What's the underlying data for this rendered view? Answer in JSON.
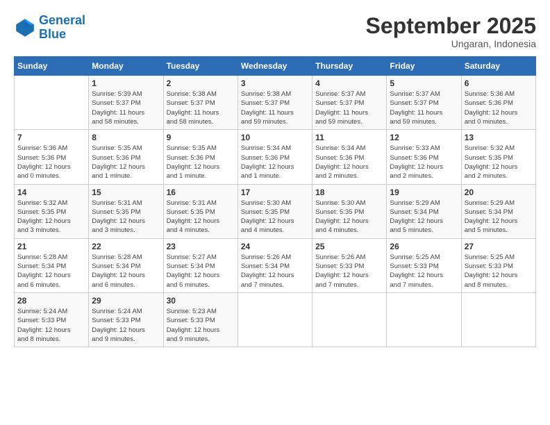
{
  "logo": {
    "line1": "General",
    "line2": "Blue"
  },
  "header": {
    "month": "September 2025",
    "location": "Ungaran, Indonesia"
  },
  "days_of_week": [
    "Sunday",
    "Monday",
    "Tuesday",
    "Wednesday",
    "Thursday",
    "Friday",
    "Saturday"
  ],
  "weeks": [
    [
      {
        "num": "",
        "info": ""
      },
      {
        "num": "1",
        "info": "Sunrise: 5:39 AM\nSunset: 5:37 PM\nDaylight: 11 hours\nand 58 minutes."
      },
      {
        "num": "2",
        "info": "Sunrise: 5:38 AM\nSunset: 5:37 PM\nDaylight: 11 hours\nand 58 minutes."
      },
      {
        "num": "3",
        "info": "Sunrise: 5:38 AM\nSunset: 5:37 PM\nDaylight: 11 hours\nand 59 minutes."
      },
      {
        "num": "4",
        "info": "Sunrise: 5:37 AM\nSunset: 5:37 PM\nDaylight: 11 hours\nand 59 minutes."
      },
      {
        "num": "5",
        "info": "Sunrise: 5:37 AM\nSunset: 5:37 PM\nDaylight: 11 hours\nand 59 minutes."
      },
      {
        "num": "6",
        "info": "Sunrise: 5:36 AM\nSunset: 5:36 PM\nDaylight: 12 hours\nand 0 minutes."
      }
    ],
    [
      {
        "num": "7",
        "info": "Sunrise: 5:36 AM\nSunset: 5:36 PM\nDaylight: 12 hours\nand 0 minutes."
      },
      {
        "num": "8",
        "info": "Sunrise: 5:35 AM\nSunset: 5:36 PM\nDaylight: 12 hours\nand 1 minute."
      },
      {
        "num": "9",
        "info": "Sunrise: 5:35 AM\nSunset: 5:36 PM\nDaylight: 12 hours\nand 1 minute."
      },
      {
        "num": "10",
        "info": "Sunrise: 5:34 AM\nSunset: 5:36 PM\nDaylight: 12 hours\nand 1 minute."
      },
      {
        "num": "11",
        "info": "Sunrise: 5:34 AM\nSunset: 5:36 PM\nDaylight: 12 hours\nand 2 minutes."
      },
      {
        "num": "12",
        "info": "Sunrise: 5:33 AM\nSunset: 5:36 PM\nDaylight: 12 hours\nand 2 minutes."
      },
      {
        "num": "13",
        "info": "Sunrise: 5:32 AM\nSunset: 5:35 PM\nDaylight: 12 hours\nand 2 minutes."
      }
    ],
    [
      {
        "num": "14",
        "info": "Sunrise: 5:32 AM\nSunset: 5:35 PM\nDaylight: 12 hours\nand 3 minutes."
      },
      {
        "num": "15",
        "info": "Sunrise: 5:31 AM\nSunset: 5:35 PM\nDaylight: 12 hours\nand 3 minutes."
      },
      {
        "num": "16",
        "info": "Sunrise: 5:31 AM\nSunset: 5:35 PM\nDaylight: 12 hours\nand 4 minutes."
      },
      {
        "num": "17",
        "info": "Sunrise: 5:30 AM\nSunset: 5:35 PM\nDaylight: 12 hours\nand 4 minutes."
      },
      {
        "num": "18",
        "info": "Sunrise: 5:30 AM\nSunset: 5:35 PM\nDaylight: 12 hours\nand 4 minutes."
      },
      {
        "num": "19",
        "info": "Sunrise: 5:29 AM\nSunset: 5:34 PM\nDaylight: 12 hours\nand 5 minutes."
      },
      {
        "num": "20",
        "info": "Sunrise: 5:29 AM\nSunset: 5:34 PM\nDaylight: 12 hours\nand 5 minutes."
      }
    ],
    [
      {
        "num": "21",
        "info": "Sunrise: 5:28 AM\nSunset: 5:34 PM\nDaylight: 12 hours\nand 6 minutes."
      },
      {
        "num": "22",
        "info": "Sunrise: 5:28 AM\nSunset: 5:34 PM\nDaylight: 12 hours\nand 6 minutes."
      },
      {
        "num": "23",
        "info": "Sunrise: 5:27 AM\nSunset: 5:34 PM\nDaylight: 12 hours\nand 6 minutes."
      },
      {
        "num": "24",
        "info": "Sunrise: 5:26 AM\nSunset: 5:34 PM\nDaylight: 12 hours\nand 7 minutes."
      },
      {
        "num": "25",
        "info": "Sunrise: 5:26 AM\nSunset: 5:33 PM\nDaylight: 12 hours\nand 7 minutes."
      },
      {
        "num": "26",
        "info": "Sunrise: 5:25 AM\nSunset: 5:33 PM\nDaylight: 12 hours\nand 7 minutes."
      },
      {
        "num": "27",
        "info": "Sunrise: 5:25 AM\nSunset: 5:33 PM\nDaylight: 12 hours\nand 8 minutes."
      }
    ],
    [
      {
        "num": "28",
        "info": "Sunrise: 5:24 AM\nSunset: 5:33 PM\nDaylight: 12 hours\nand 8 minutes."
      },
      {
        "num": "29",
        "info": "Sunrise: 5:24 AM\nSunset: 5:33 PM\nDaylight: 12 hours\nand 9 minutes."
      },
      {
        "num": "30",
        "info": "Sunrise: 5:23 AM\nSunset: 5:33 PM\nDaylight: 12 hours\nand 9 minutes."
      },
      {
        "num": "",
        "info": ""
      },
      {
        "num": "",
        "info": ""
      },
      {
        "num": "",
        "info": ""
      },
      {
        "num": "",
        "info": ""
      }
    ]
  ]
}
